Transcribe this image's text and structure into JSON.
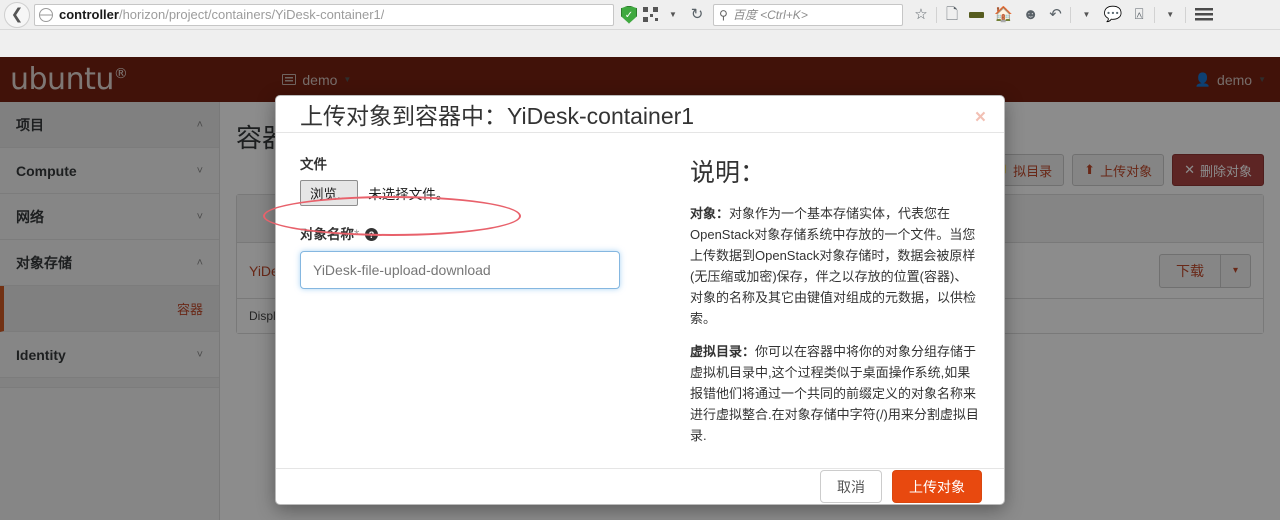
{
  "browser": {
    "back_icon": "back-arrow-icon",
    "url_host": "controller",
    "url_path": "/horizon/project/containers/YiDesk-container1/",
    "search_placeholder": "百度 <Ctrl+K>",
    "icons": [
      "shield-icon",
      "qr-code-icon",
      "dropdown-caret-icon",
      "reload-icon",
      "star-icon",
      "reader-icon",
      "dash-icon",
      "home-icon",
      "smiley-icon",
      "undo-icon",
      "caret-icon",
      "chat-icon",
      "crop-icon",
      "caret-icon",
      "hamburger-menu-icon"
    ]
  },
  "header": {
    "logo": "ubuntu",
    "logo_sup": "®",
    "project_switcher": "demo",
    "user_menu": "demo"
  },
  "sidebar": {
    "sections": [
      {
        "label": "项目",
        "chevron": "˄",
        "active": true
      },
      {
        "label": "Compute",
        "chevron": "˅",
        "active": false
      },
      {
        "label": "网络",
        "chevron": "˅",
        "active": false
      },
      {
        "label": "对象存储",
        "chevron": "˄",
        "active": false
      }
    ],
    "sub_item": "容器",
    "last_section": {
      "label": "Identity",
      "chevron": "˅"
    }
  },
  "page": {
    "title": "容器",
    "actions": [
      {
        "label": "拟目录",
        "icon": "folder-plus-icon"
      },
      {
        "label": "上传对象",
        "icon": "upload-icon"
      },
      {
        "label": "删除对象",
        "icon": "close-icon",
        "danger": true
      }
    ],
    "row_link": "YiDes",
    "download_button": "下载",
    "download_caret": "▾",
    "footer_text": "Display"
  },
  "modal": {
    "title": "上传对象到容器中：YiDesk-container1",
    "close": "×",
    "file_label": "文件",
    "browse_button": "浏览...",
    "file_status": "未选择文件。",
    "object_name_label": "对象名称",
    "required_marker": "*",
    "help_icon": "?",
    "object_name_value": "YiDesk-file-upload-download",
    "description_title": "说明：",
    "paragraphs": [
      {
        "term": "对象：",
        "text": "对象作为一个基本存储实体，代表您在OpenStack对象存储系统中存放的一个文件。当您上传数据到OpenStack对象存储时，数据会被原样(无压缩或加密)保存，伴之以存放的位置(容器)、对象的名称及其它由键值对组成的元数据，以供检索。"
      },
      {
        "term": "虚拟目录：",
        "text": "你可以在容器中将你的对象分组存储于虚拟机目录中,这个过程类似于桌面操作系统,如果报错他们将通过一个共同的前缀定义的对象名称来进行虚拟整合.在对象存储中字符(/)用来分割虚拟目录."
      }
    ],
    "cancel_button": "取消",
    "submit_button": "上传对象"
  },
  "annotation": {
    "shape": "red-ellipse",
    "color": "#e8616b",
    "target": "file-browse-row"
  },
  "colors": {
    "ubuntu_brand": "#772211",
    "accent_orange": "#e8490f",
    "link_red": "#c0492b",
    "annotation_red": "#e8616b"
  }
}
